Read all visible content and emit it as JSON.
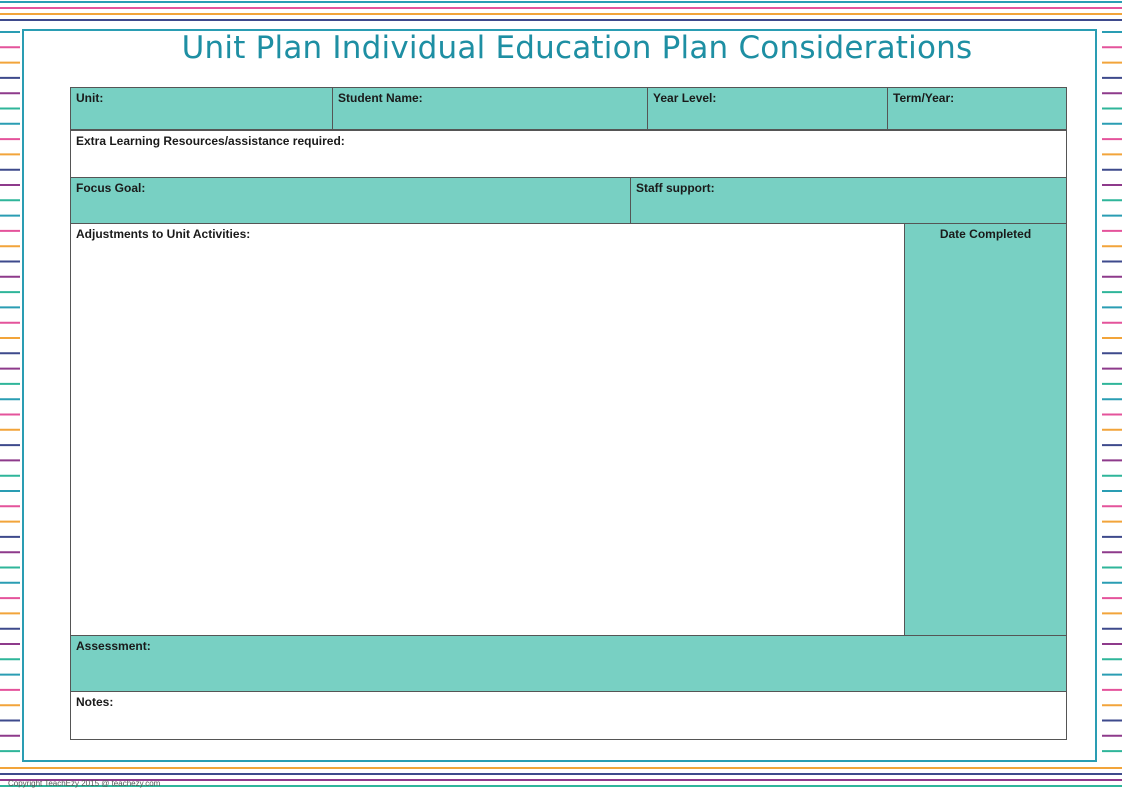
{
  "title": "Unit Plan Individual Education Plan Considerations",
  "header_row": {
    "unit": "Unit:",
    "student_name": "Student Name:",
    "year_level": "Year Level:",
    "term_year": "Term/Year:"
  },
  "extra_resources": "Extra Learning Resources/assistance  required:",
  "focus_goal": "Focus Goal:",
  "staff_support": "Staff support:",
  "adjustments": "Adjustments  to Unit Activities:",
  "date_completed": "Date Completed",
  "assessment": "Assessment:",
  "notes": "Notes:",
  "copyright": "Copyright TeachEzy 2015 @ teachezy.com",
  "colors": {
    "teal_fill": "#78d0c3",
    "title_teal": "#1e8fa3",
    "frame_border": "#2a9db3",
    "stripe_colors": [
      "#2a9db3",
      "#e4539b",
      "#f2a43a",
      "#3e4a8c",
      "#8e3a8b",
      "#2fb59a"
    ]
  }
}
